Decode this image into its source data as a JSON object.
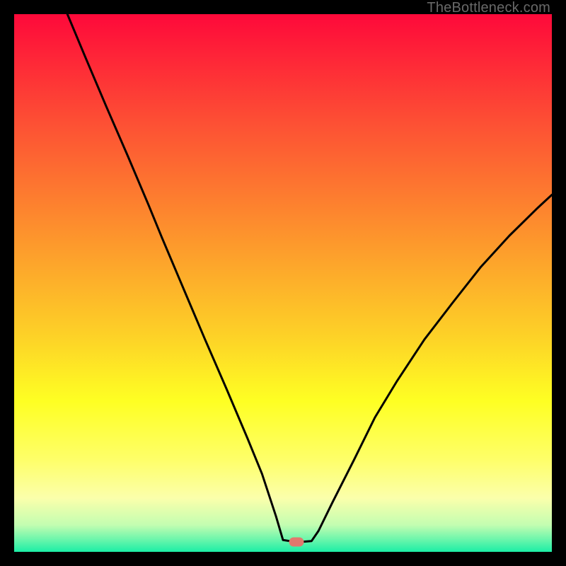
{
  "watermark": "TheBottleneck.com",
  "marker": {
    "color": "#e2786d",
    "x_frac": 0.525,
    "y_frac": 0.982
  },
  "chart_data": {
    "type": "line",
    "title": "",
    "xlabel": "",
    "ylabel": "",
    "xlim": [
      0,
      100
    ],
    "ylim": [
      0,
      100
    ],
    "grid": false,
    "legend": false,
    "annotations": [
      "TheBottleneck.com"
    ],
    "background_gradient_stops": [
      {
        "offset": 0.0,
        "color": "#fe093a"
      },
      {
        "offset": 0.2,
        "color": "#fd4f34"
      },
      {
        "offset": 0.4,
        "color": "#fd902d"
      },
      {
        "offset": 0.6,
        "color": "#fdd227"
      },
      {
        "offset": 0.72,
        "color": "#feff23"
      },
      {
        "offset": 0.83,
        "color": "#feff6a"
      },
      {
        "offset": 0.9,
        "color": "#fbffab"
      },
      {
        "offset": 0.95,
        "color": "#c3fdb1"
      },
      {
        "offset": 0.975,
        "color": "#72f6ac"
      },
      {
        "offset": 1.0,
        "color": "#1ceea6"
      }
    ],
    "series": [
      {
        "name": "bottleneck-curve",
        "color": "#000000",
        "stroke_width": 3,
        "x": [
          9.9,
          13.2,
          17.1,
          21.1,
          25.0,
          27.5,
          31.6,
          35.5,
          39.5,
          43.4,
          46.1,
          48.7,
          50.0,
          52.6,
          55.3,
          56.6,
          59.2,
          63.2,
          67.1,
          71.1,
          76.3,
          81.6,
          86.8,
          92.1,
          97.4,
          100.0
        ],
        "y": [
          100.0,
          92.1,
          82.9,
          73.7,
          64.5,
          58.4,
          48.7,
          39.5,
          30.3,
          21.1,
          14.5,
          6.6,
          2.2,
          1.8,
          2.0,
          3.9,
          9.2,
          17.1,
          25.0,
          31.6,
          39.5,
          46.4,
          53.0,
          58.8,
          64.0,
          66.4
        ]
      }
    ]
  }
}
